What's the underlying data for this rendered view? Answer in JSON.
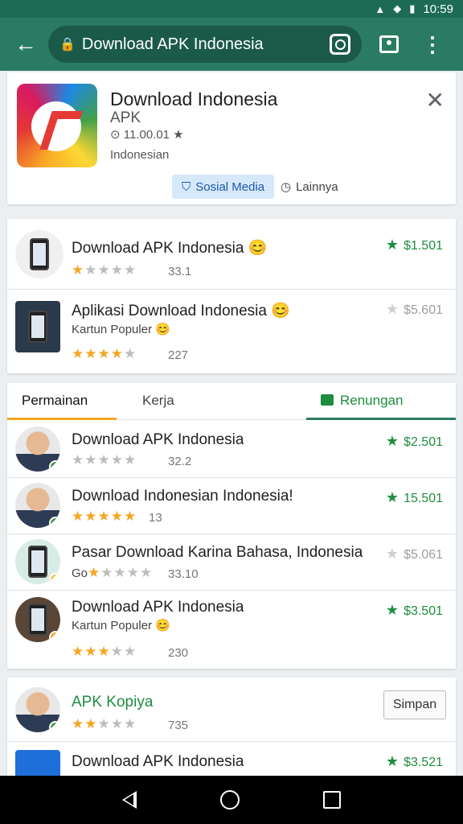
{
  "status": {
    "time": "10:59"
  },
  "toolbar": {
    "url": "Download APK Indonesia"
  },
  "app": {
    "title": "Download Indonesia",
    "subtitle": "APK",
    "rating": "⊙ 11.00.01 ★",
    "developer": "Indonesian",
    "badge_primary": "Sosial Media",
    "badge_secondary": "Lainnya"
  },
  "featured": [
    {
      "title": "Download APK Indonesia 😊",
      "sub": "",
      "stars": 1,
      "count": "33.1",
      "price": "$1.501",
      "price_active": true
    },
    {
      "title": "Aplikasi Download Indonesia 😊",
      "sub": "Kartun Populer 😊",
      "stars": 3.5,
      "count": "227",
      "price": "$5.601",
      "price_active": false
    }
  ],
  "tabs": {
    "tab1": "Permainan",
    "tab2": "Kerja",
    "tab3": "Renungan"
  },
  "tab_list": [
    {
      "title": "Download APK Indonesia",
      "sub": "",
      "stars": 0,
      "count": "32.2",
      "price": "$2.501",
      "price_active": true
    },
    {
      "title": "Download Indonesian Indonesia!",
      "sub": "",
      "stars": 5,
      "count": "13",
      "price": "15.501",
      "price_active": true
    },
    {
      "title": "Pasar Download Karina Bahasa, Indonesia",
      "sub": "Go",
      "stars": 1,
      "count": "33.10",
      "price": "$5.061",
      "price_active": false
    },
    {
      "title": "Download APK Indonesia",
      "sub": "Kartun Populer 😊",
      "stars": 2.5,
      "count": "230",
      "price": "$3.501",
      "price_active": true
    }
  ],
  "bottom_list": [
    {
      "title": "APK Kopiya",
      "stars": 2,
      "count": "735",
      "action": "Simpan"
    },
    {
      "title": "Download APK Indonesia",
      "price": "$3.521",
      "price_active": true
    }
  ],
  "colors": {
    "app_bar": "#2a7b62",
    "accent_green": "#1e8e3e",
    "star": "#f5a623"
  }
}
